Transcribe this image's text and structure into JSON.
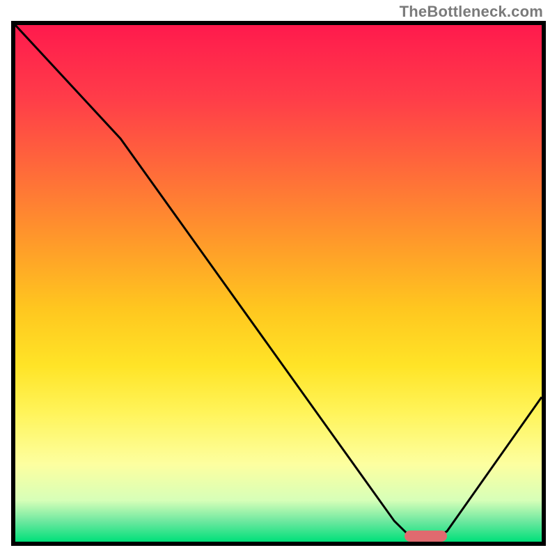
{
  "attribution": "TheBottleneck.com",
  "chart_data": {
    "type": "line",
    "title": "",
    "xlabel": "",
    "ylabel": "",
    "xlim": [
      0,
      100
    ],
    "ylim": [
      0,
      100
    ],
    "grid": false,
    "legend": false,
    "background_gradient": {
      "orientation": "vertical",
      "stops": [
        {
          "pos": 0.0,
          "color": "#ff1a4d"
        },
        {
          "pos": 0.5,
          "color": "#ffc71f"
        },
        {
          "pos": 0.8,
          "color": "#fdffa0"
        },
        {
          "pos": 1.0,
          "color": "#00e07a"
        }
      ]
    },
    "series": [
      {
        "name": "bottleneck-curve",
        "color": "#000000",
        "stroke_width": 2.5,
        "x": [
          0,
          20,
          72,
          75,
          80,
          82,
          100
        ],
        "values": [
          100,
          78,
          4,
          1,
          1,
          2,
          28
        ]
      }
    ],
    "marker": {
      "name": "optimal-range",
      "color": "#e06a6f",
      "shape": "rounded-bar",
      "x_start": 74,
      "x_end": 82,
      "y": 1
    }
  }
}
